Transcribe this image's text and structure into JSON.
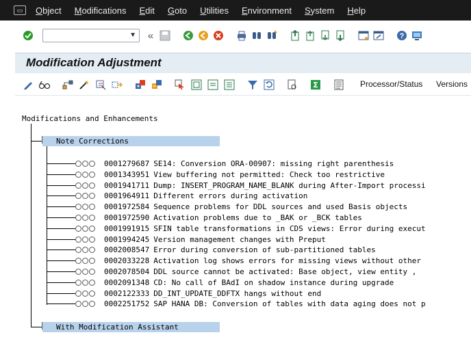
{
  "menu": {
    "items": [
      "Object",
      "Modifications",
      "Edit",
      "Goto",
      "Utilities",
      "Environment",
      "System",
      "Help"
    ]
  },
  "toolbar": {
    "command_field": "",
    "icons": [
      "enter-icon",
      "back-arrows-icon",
      "save-icon",
      "back-icon",
      "exit-icon",
      "cancel-icon",
      "print-icon",
      "find-icon",
      "find-next-icon",
      "first-page-icon",
      "previous-page-icon",
      "next-page-icon",
      "last-page-icon",
      "new-session-icon",
      "shortcut-icon",
      "help-icon",
      "customize-layout-icon"
    ]
  },
  "title": "Modification Adjustment",
  "app_toolbar": {
    "processor_label": "Processor/Status",
    "versions_label": "Versions"
  },
  "tree": {
    "root": "Modifications and Enhancements",
    "folder1": "Note Corrections",
    "folder2": "With Modification Assistant",
    "notes": [
      {
        "num": "0001279687",
        "text": "SE14: Conversion ORA-00907: missing right parenthesis"
      },
      {
        "num": "0001343951",
        "text": "View buffering not permitted: Check too restrictive"
      },
      {
        "num": "0001941711",
        "text": "Dump: INSERT_PROGRAM_NAME_BLANK during After-Import processi"
      },
      {
        "num": "0001964911",
        "text": "Different errors during activation"
      },
      {
        "num": "0001972584",
        "text": "Sequence problems for DDL sources and used Basis objects"
      },
      {
        "num": "0001972590",
        "text": "Activation problems due to _BAK or _BCK tables"
      },
      {
        "num": "0001991915",
        "text": "SFIN table transformations in CDS views: Error during execut"
      },
      {
        "num": "0001994245",
        "text": "Version management changes with Preput"
      },
      {
        "num": "0002008547",
        "text": "Error during conversion of sub-partitioned tables"
      },
      {
        "num": "0002033228",
        "text": "Activation log shows errors for missing views without other"
      },
      {
        "num": "0002078504",
        "text": "DDL source cannot be activated: Base object, view entity  ,"
      },
      {
        "num": "0002091348",
        "text": "CD: No call of BAdI on shadow instance during upgrade"
      },
      {
        "num": "0002122333",
        "text": "DD_INT_UPDATE_DDFTX hangs without end"
      },
      {
        "num": "0002251752",
        "text": "SAP HANA DB: Conversion of tables with data aging does not p"
      }
    ]
  }
}
